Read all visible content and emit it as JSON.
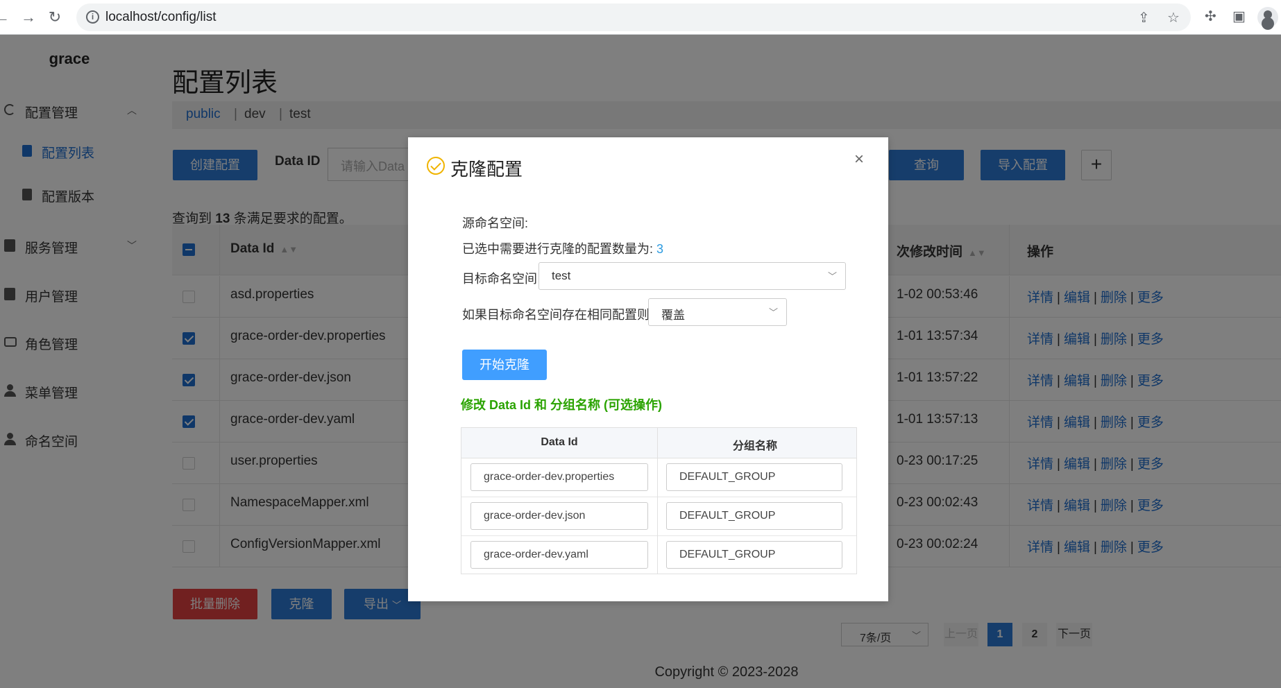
{
  "browser": {
    "url": "localhost/config/list"
  },
  "sidebar": {
    "brand": "grace",
    "items": [
      {
        "label": "配置管理"
      },
      {
        "label": "配置列表"
      },
      {
        "label": "配置版本"
      },
      {
        "label": "服务管理"
      },
      {
        "label": "用户管理"
      },
      {
        "label": "角色管理"
      },
      {
        "label": "菜单管理"
      },
      {
        "label": "命名空间"
      }
    ]
  },
  "main": {
    "title": "配置列表",
    "namespaces": [
      "public",
      "dev",
      "test"
    ],
    "toolbar": {
      "create_label": "创建配置",
      "dataid_label": "Data ID",
      "dataid_placeholder": "请输入Data",
      "query_label": "查询",
      "import_label": "导入配置",
      "plus_label": "+"
    },
    "result": {
      "prefix": "查询到 ",
      "count": "13",
      "suffix": " 条满足要求的配置。"
    },
    "table": {
      "headers": {
        "dataid": "Data Id",
        "modified": "次修改时间",
        "ops": "操作"
      },
      "rows": [
        {
          "dataid": "asd.properties",
          "time": "1-02 00:53:46",
          "checked": false
        },
        {
          "dataid": "grace-order-dev.properties",
          "time": "1-01 13:57:34",
          "checked": true
        },
        {
          "dataid": "grace-order-dev.json",
          "time": "1-01 13:57:22",
          "checked": true
        },
        {
          "dataid": "grace-order-dev.yaml",
          "time": "1-01 13:57:13",
          "checked": true
        },
        {
          "dataid": "user.properties",
          "time": "0-23 00:17:25",
          "checked": false
        },
        {
          "dataid": "NamespaceMapper.xml",
          "time": "0-23 00:02:43",
          "checked": false
        },
        {
          "dataid": "ConfigVersionMapper.xml",
          "time": "0-23 00:02:24",
          "checked": false
        }
      ],
      "ops": {
        "detail": "详情",
        "edit": "编辑",
        "delete": "删除",
        "more": "更多",
        "sep": "|"
      }
    },
    "bottom": {
      "batch_delete": "批量删除",
      "clone": "克隆",
      "export": "导出"
    },
    "pagination": {
      "page_size": "7条/页",
      "prev": "上一页",
      "pages": [
        "1",
        "2"
      ],
      "current": "1",
      "next": "下一页"
    },
    "copyright": "Copyright © 2023-2028"
  },
  "dialog": {
    "title": "克隆配置",
    "close": "×",
    "source_ns_label": "源命名空间:",
    "selected_text": "已选中需要进行克隆的配置数量为: ",
    "selected_count": "3",
    "target_ns_label": "目标命名空间",
    "target_ns_value": "test",
    "conflict_label": "如果目标命名空间存在相同配置则",
    "conflict_value": "覆盖",
    "start_button": "开始克隆",
    "modify_hint": "修改 Data Id 和 分组名称 (可选操作)",
    "table": {
      "headers": {
        "dataid": "Data Id",
        "group": "分组名称"
      },
      "rows": [
        {
          "dataid": "grace-order-dev.properties",
          "group": "DEFAULT_GROUP"
        },
        {
          "dataid": "grace-order-dev.json",
          "group": "DEFAULT_GROUP"
        },
        {
          "dataid": "grace-order-dev.yaml",
          "group": "DEFAULT_GROUP"
        }
      ]
    }
  },
  "colors": {
    "primary": "#2d7ad6",
    "danger": "#e34040",
    "dialog_button": "#409eff",
    "hint_green": "#2aa300",
    "count_blue": "#2d9be0",
    "title_icon": "#f0b400"
  },
  "icons": {
    "back": "arrow-left-icon",
    "forward": "arrow-right-icon",
    "reload": "reload-icon",
    "info": "info-icon",
    "share": "share-icon",
    "star": "star-icon",
    "extensions": "puzzle-icon",
    "sidepanel": "sidepanel-icon",
    "profile": "profile-icon"
  }
}
